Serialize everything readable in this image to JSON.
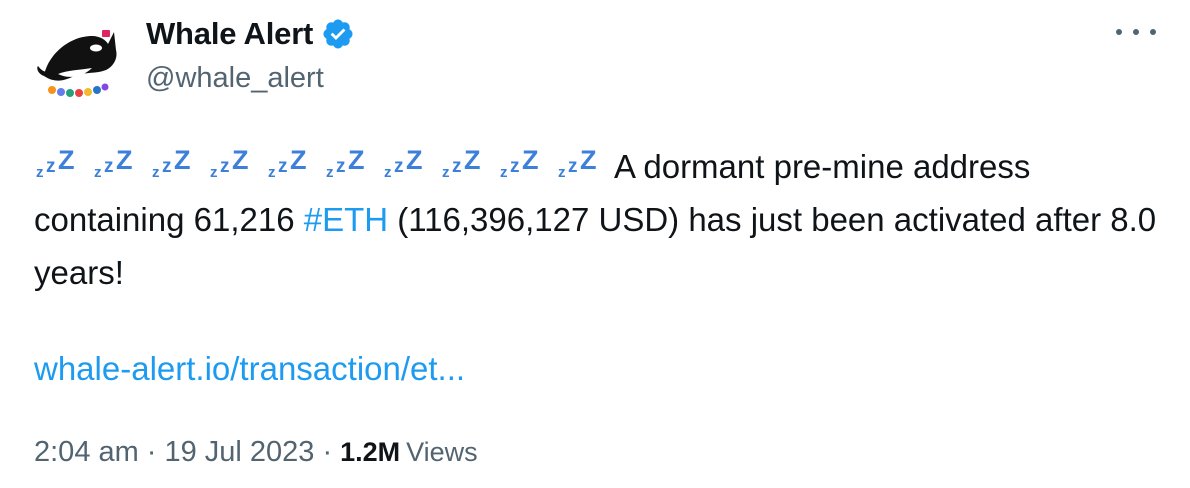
{
  "tweet": {
    "author": {
      "display_name": "Whale Alert",
      "handle": "@whale_alert",
      "verified": true,
      "verified_color": "#1d9bf0"
    },
    "body": {
      "zzz_icon": "zzz-emoji",
      "zzz_count": 10,
      "text_before_hashtag": "A dormant pre-mine address containing 61,216 ",
      "hashtag": "#ETH",
      "text_after_hashtag": " (116,396,127 USD) has just been activated after 8.0 years!"
    },
    "link": "whale-alert.io/transaction/et...",
    "meta": {
      "time": "2:04 am",
      "date": "19 Jul 2023",
      "separator": "·",
      "views_count": "1.2M",
      "views_label": "Views"
    },
    "more_icon": "more-horizontal-icon",
    "colors": {
      "link": "#1d9bf0",
      "secondary_text": "#536471",
      "primary_text": "#0f1419",
      "zzz": "#3d80d9"
    }
  }
}
